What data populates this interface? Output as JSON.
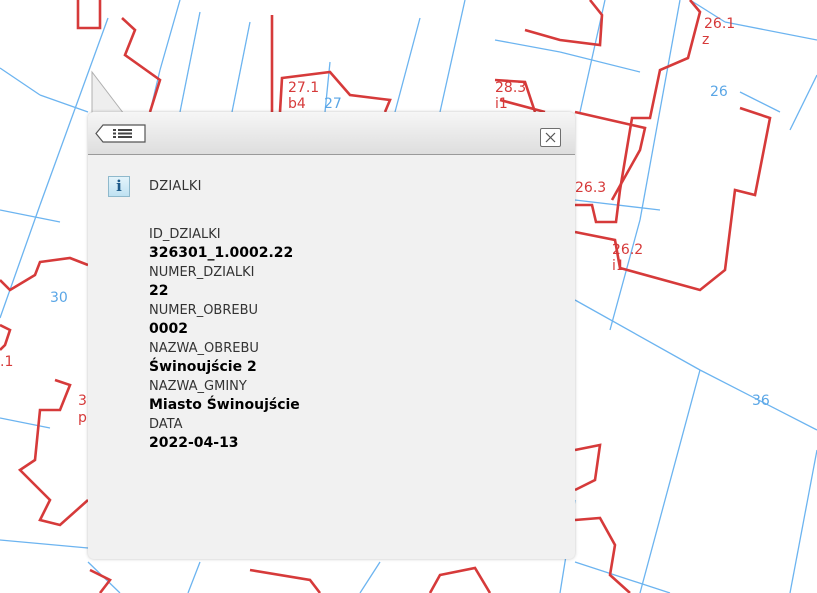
{
  "map": {
    "labels_red": [
      "26.1",
      "z",
      "27.1",
      "b4",
      "28.3",
      "i1",
      "26.3",
      "26.2",
      "i1",
      ".1",
      "3",
      "p"
    ],
    "labels_blue": [
      "26",
      "27",
      "30",
      "36"
    ]
  },
  "popup": {
    "layer_name": "DZIALKI",
    "info_icon_glyph": "i",
    "attributes": [
      {
        "name": "ID_DZIALKI",
        "value": "326301_1.0002.22"
      },
      {
        "name": "NUMER_DZIALKI",
        "value": "22"
      },
      {
        "name": "NUMER_OBREBU",
        "value": "0002"
      },
      {
        "name": "NAZWA_OBREBU",
        "value": "Świnoujście 2"
      },
      {
        "name": "NAZWA_GMINY",
        "value": "Miasto Świnoujście"
      },
      {
        "name": "DATA",
        "value": "2022-04-13"
      }
    ]
  },
  "colors": {
    "building_outline": "#d63a3a",
    "parcel_line": "#6cb4f0",
    "popup_background": "#f1f1f1"
  }
}
